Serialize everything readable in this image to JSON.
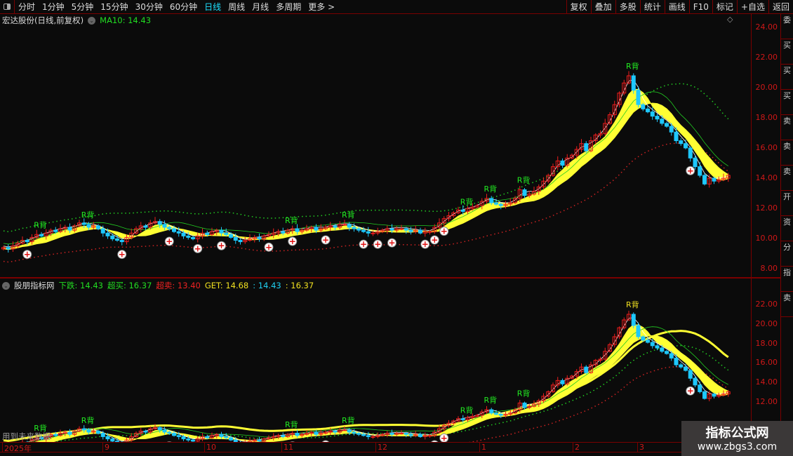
{
  "toolbar": {
    "periods": [
      "分时",
      "1分钟",
      "5分钟",
      "15分钟",
      "30分钟",
      "60分钟",
      "日线",
      "周线",
      "月线",
      "多周期",
      "更多 >"
    ],
    "active": "日线",
    "actions": [
      "复权",
      "叠加",
      "多股",
      "统计",
      "画线",
      "F10",
      "标记",
      "+自选",
      "返回"
    ]
  },
  "main_panel": {
    "title": "宏达股份(日线,前复权)",
    "ma_label": "MA10: 14.43",
    "y_ticks": [
      "24.00",
      "22.00",
      "20.00",
      "18.00",
      "16.00",
      "14.00",
      "12.00",
      "10.00",
      "8.00"
    ]
  },
  "sub_panel": {
    "title": "股朋指标网",
    "fields": [
      {
        "text": "下跌: 14.43",
        "color": "#22dd22"
      },
      {
        "text": "超买: 16.37",
        "color": "#22dd22"
      },
      {
        "text": "超卖: 13.40",
        "color": "#ee2222"
      },
      {
        "text": "GET: 14.68",
        "color": "#f0e020"
      },
      {
        "text": ": 14.43",
        "color": "#20d0f0"
      },
      {
        "text": ": 16.37",
        "color": "#f0e020"
      }
    ],
    "y_ticks": [
      "22.00",
      "20.00",
      "18.00",
      "16.00",
      "14.00",
      "12.00"
    ],
    "note": "用到未来数据"
  },
  "date_axis": [
    "2025年",
    "9",
    "10",
    "11",
    "12",
    "1",
    "2",
    "3"
  ],
  "side_tabs": [
    "委",
    "买",
    "买",
    "买",
    "卖",
    "卖",
    "卖",
    "开",
    "资",
    "分",
    "指",
    "卖"
  ],
  "watermark": {
    "name": "指标公式网",
    "url": "www.zbgs3.com"
  },
  "colors": {
    "up": "#ee1c1c",
    "down": "#1ec8ff",
    "ribbon": "#ffff33",
    "upper_dots": "#22cc22",
    "lower_dots": "#cc2222",
    "axis": "#d01818"
  },
  "chart_data": {
    "type": "candlestick",
    "ylim_main": [
      7.5,
      25
    ],
    "ylim_sub": [
      11,
      23.5
    ],
    "close": [
      9.6,
      9.5,
      9.7,
      9.9,
      10.1,
      10.0,
      10.3,
      10.5,
      10.4,
      10.6,
      10.8,
      10.7,
      10.9,
      11.0,
      10.8,
      11.1,
      11.3,
      11.2,
      11.0,
      11.1,
      10.9,
      10.6,
      10.4,
      10.2,
      10.1,
      10.0,
      10.3,
      10.6,
      10.9,
      11.1,
      11.0,
      11.3,
      11.4,
      11.2,
      11.0,
      10.9,
      10.7,
      10.6,
      10.4,
      10.3,
      10.2,
      10.4,
      10.6,
      10.5,
      10.7,
      10.8,
      10.6,
      10.5,
      10.3,
      10.1,
      10.0,
      10.1,
      10.2,
      10.3,
      10.2,
      10.4,
      10.5,
      10.6,
      10.7,
      10.6,
      10.8,
      10.9,
      10.7,
      10.8,
      10.9,
      11.0,
      10.8,
      10.9,
      11.0,
      11.1,
      11.0,
      11.2,
      11.2,
      11.0,
      10.9,
      10.8,
      10.7,
      10.6,
      10.6,
      10.7,
      10.8,
      10.9,
      10.8,
      10.9,
      10.9,
      10.8,
      10.7,
      10.8,
      10.6,
      10.7,
      10.7,
      11.0,
      11.3,
      11.6,
      11.8,
      12.0,
      12.2,
      12.1,
      12.3,
      12.4,
      12.5,
      12.8,
      13.0,
      12.7,
      12.6,
      12.5,
      12.6,
      12.7,
      13.0,
      13.6,
      13.2,
      13.3,
      13.5,
      13.8,
      14.2,
      14.6,
      15.2,
      15.6,
      15.3,
      15.8,
      16.0,
      16.4,
      16.8,
      16.3,
      17.0,
      17.4,
      17.5,
      18.2,
      18.8,
      19.5,
      20.3,
      21.0,
      21.5,
      20.5,
      19.5,
      19.2,
      19.0,
      18.7,
      18.5,
      18.2,
      18.0,
      17.6,
      17.0,
      16.8,
      16.5,
      15.8,
      15.2,
      14.6,
      14.0,
      14.4,
      14.2,
      14.3,
      14.4,
      14.6
    ],
    "annotations": [
      {
        "i": 7,
        "label": "R背"
      },
      {
        "i": 17,
        "label": "R背"
      },
      {
        "i": 60,
        "label": "R背"
      },
      {
        "i": 72,
        "label": "R背"
      },
      {
        "i": 97,
        "label": "R背"
      },
      {
        "i": 102,
        "label": "R背"
      },
      {
        "i": 109,
        "label": "R背"
      },
      {
        "i": 132,
        "label": "R背"
      }
    ],
    "buy_marks": [
      5,
      25,
      35,
      41,
      46,
      56,
      61,
      68,
      76,
      79,
      82,
      89,
      91,
      93,
      145
    ]
  }
}
